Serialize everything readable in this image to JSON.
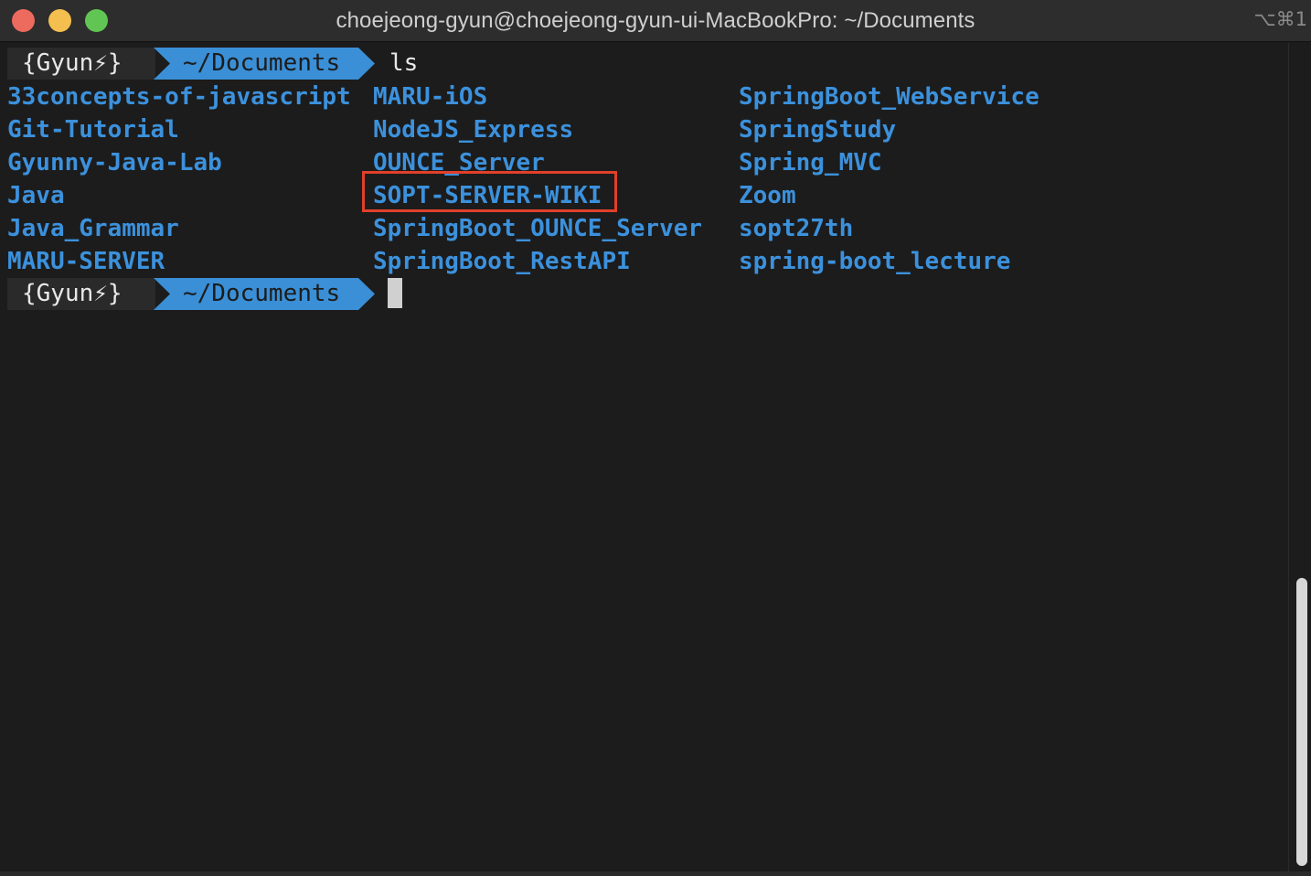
{
  "window": {
    "title": "choejeong-gyun@choejeong-gyun-ui-MacBookPro: ~/Documents",
    "shortcut": "⌥⌘1"
  },
  "prompt": {
    "user": "{Gyun⚡}",
    "dir": "~/Documents",
    "command": "ls"
  },
  "listing": {
    "col1": [
      "33concepts-of-javascript",
      "Git-Tutorial",
      "Gyunny-Java-Lab",
      "Java",
      "Java_Grammar",
      "MARU-SERVER"
    ],
    "col2": [
      "MARU-iOS",
      "NodeJS_Express",
      "OUNCE_Server",
      "SOPT-SERVER-WIKI",
      "SpringBoot_OUNCE_Server",
      "SpringBoot_RestAPI"
    ],
    "col3": [
      "SpringBoot_WebService",
      "SpringStudy",
      "Spring_MVC",
      "Zoom",
      "sopt27th",
      "spring-boot_lecture"
    ],
    "highlighted": "SOPT-SERVER-WIKI"
  },
  "colors": {
    "background": "#1c1c1c",
    "directory": "#3c91dc",
    "prompt_dir_bg": "#3a8fd6",
    "highlight_border": "#e0402a"
  }
}
